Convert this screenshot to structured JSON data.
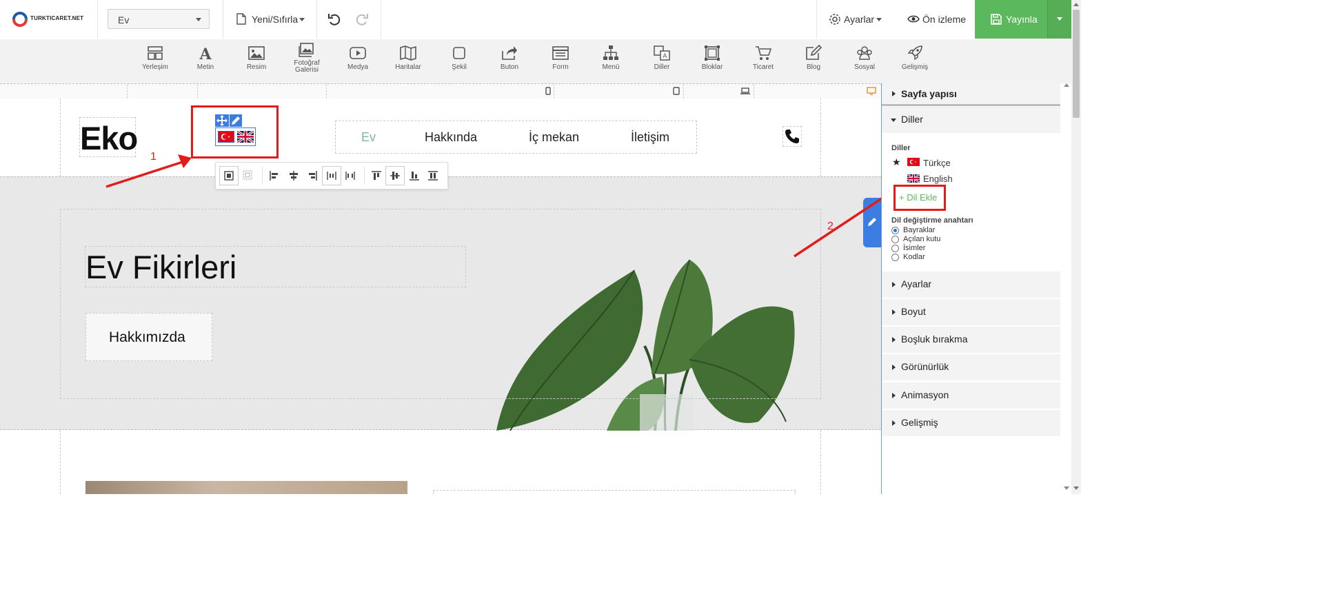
{
  "app": {
    "logo_text": "TURKTICARET.NET"
  },
  "topbar": {
    "page_select_value": "Ev",
    "new_reset_label": "Yeni/Sıfırla",
    "settings_label": "Ayarlar",
    "preview_label": "Ön izleme",
    "publish_label": "Yayınla"
  },
  "toolbar": {
    "items": [
      {
        "label": "Yerleşim",
        "icon": "layout-icon"
      },
      {
        "label": "Metin",
        "icon": "text-icon"
      },
      {
        "label": "Resim",
        "icon": "image-icon"
      },
      {
        "label": "Fotoğraf Galerisi",
        "line1": "Fotoğraf",
        "line2": "Galerisi",
        "icon": "gallery-icon"
      },
      {
        "label": "Medya",
        "icon": "media-icon"
      },
      {
        "label": "Haritalar",
        "icon": "map-icon"
      },
      {
        "label": "Şekil",
        "icon": "shape-icon"
      },
      {
        "label": "Buton",
        "icon": "button-icon"
      },
      {
        "label": "Form",
        "icon": "form-icon"
      },
      {
        "label": "Menü",
        "icon": "menu-icon"
      },
      {
        "label": "Diller",
        "icon": "languages-icon"
      },
      {
        "label": "Bloklar",
        "icon": "blocks-icon"
      },
      {
        "label": "Ticaret",
        "icon": "cart-icon"
      },
      {
        "label": "Blog",
        "icon": "blog-icon"
      },
      {
        "label": "Sosyal",
        "icon": "social-icon"
      },
      {
        "label": "Gelişmiş",
        "icon": "rocket-icon"
      }
    ]
  },
  "site": {
    "logo": "Eko",
    "nav": [
      "Ev",
      "Hakkında",
      "İç mekan",
      "İletişim"
    ],
    "hero_title": "Ev Fikirleri",
    "hero_button": "Hakkımızda"
  },
  "annotations": {
    "marker1": "1",
    "marker2": "2"
  },
  "panel": {
    "sections": {
      "page_structure": "Sayfa yapısı",
      "languages": "Diller",
      "settings": "Ayarlar",
      "size": "Boyut",
      "spacing": "Boşluk bırakma",
      "visibility": "Görünürlük",
      "animation": "Animasyon",
      "advanced": "Gelişmiş"
    },
    "languages_heading": "Diller",
    "languages": [
      {
        "name": "Türkçe",
        "default": true,
        "flag": "tr-flag-icon"
      },
      {
        "name": "English",
        "default": false,
        "flag": "uk-flag-icon"
      }
    ],
    "add_language": "+ Dil Ekle",
    "switcher_heading": "Dil değiştirme anahtarı",
    "switcher_options": [
      {
        "label": "Bayraklar",
        "selected": true
      },
      {
        "label": "Açılan kutu",
        "selected": false
      },
      {
        "label": "İsimler",
        "selected": false
      },
      {
        "label": "Kodlar",
        "selected": false
      }
    ]
  },
  "colors": {
    "publish_green": "#5cb85c",
    "nav_active": "#7cb89a",
    "add_language_green": "#5cb85c",
    "annotation_red": "#e31b1b",
    "selection_blue": "#1a73e8"
  }
}
